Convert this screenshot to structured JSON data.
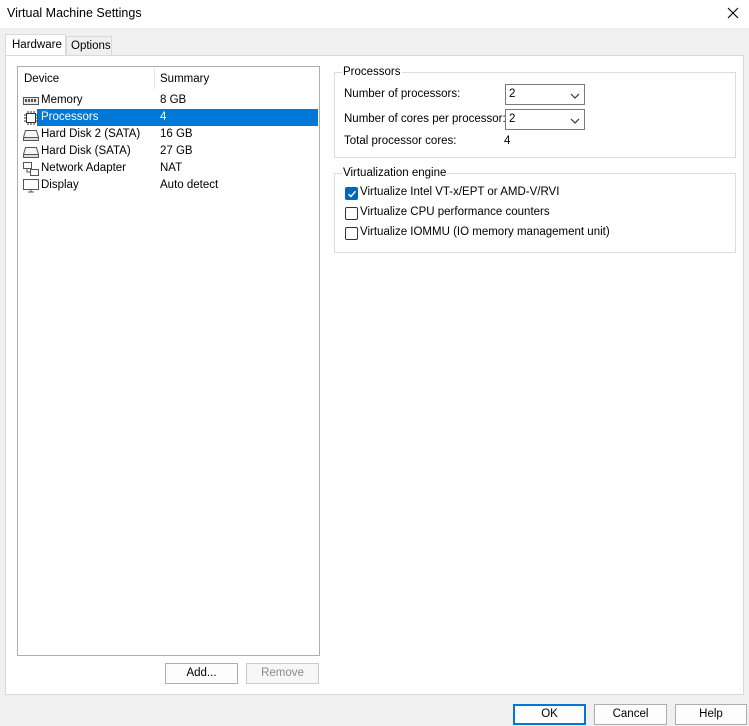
{
  "window": {
    "title": "Virtual Machine Settings",
    "close_icon": "close-icon"
  },
  "tabs": [
    {
      "label": "Hardware",
      "active": true
    },
    {
      "label": "Options",
      "active": false
    }
  ],
  "device_list": {
    "columns": {
      "device": "Device",
      "summary": "Summary"
    },
    "rows": [
      {
        "name": "Memory",
        "summary": "8 GB",
        "icon": "memory-icon",
        "selected": false
      },
      {
        "name": "Processors",
        "summary": "4",
        "icon": "processor-icon",
        "selected": true
      },
      {
        "name": "Hard Disk 2 (SATA)",
        "summary": "16 GB",
        "icon": "hard-disk-icon",
        "selected": false
      },
      {
        "name": "Hard Disk (SATA)",
        "summary": "27 GB",
        "icon": "hard-disk-icon",
        "selected": false
      },
      {
        "name": "Network Adapter",
        "summary": "NAT",
        "icon": "network-adapter-icon",
        "selected": false
      },
      {
        "name": "Display",
        "summary": "Auto detect",
        "icon": "display-icon",
        "selected": false
      }
    ],
    "add_label": "Add...",
    "remove_label": "Remove"
  },
  "processors": {
    "group_title": "Processors",
    "num_processors_label": "Number of processors:",
    "num_processors_value": "2",
    "cores_per_processor_label": "Number of cores per processor:",
    "cores_per_processor_value": "2",
    "total_cores_label": "Total processor cores:",
    "total_cores_value": "4"
  },
  "virtualization": {
    "group_title": "Virtualization engine",
    "options": [
      {
        "label": "Virtualize Intel VT-x/EPT or AMD-V/RVI",
        "checked": true
      },
      {
        "label": "Virtualize CPU performance counters",
        "checked": false
      },
      {
        "label": "Virtualize IOMMU (IO memory management unit)",
        "checked": false
      }
    ]
  },
  "footer": {
    "ok_label": "OK",
    "cancel_label": "Cancel",
    "help_label": "Help"
  },
  "colors": {
    "selection": "#0078d7",
    "checkbox_checked": "#0067c0"
  }
}
